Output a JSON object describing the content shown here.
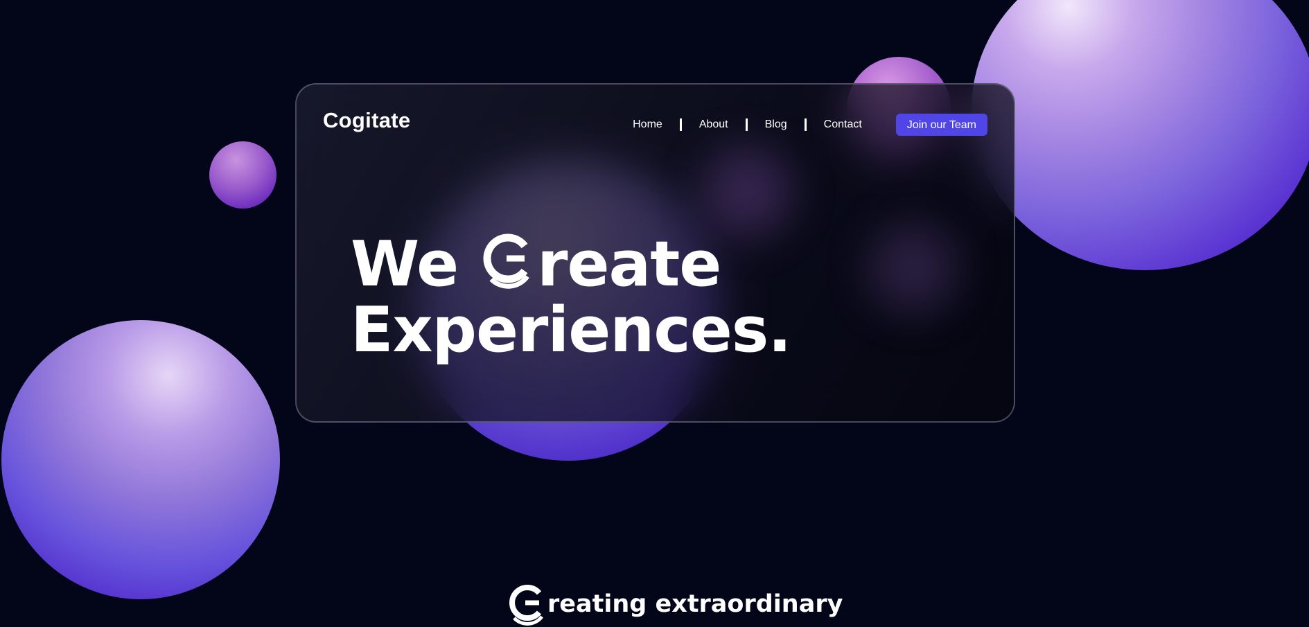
{
  "brand": {
    "name": "Cogitate"
  },
  "nav": {
    "items": [
      {
        "label": "Home"
      },
      {
        "label": "About"
      },
      {
        "label": "Blog"
      },
      {
        "label": "Contact"
      }
    ],
    "cta_label": "Join our Team"
  },
  "hero": {
    "line1_prefix": "We",
    "line1_suffix": "reate",
    "line2": "Experiences."
  },
  "tagline": {
    "text": "reating extraordinary"
  },
  "colors": {
    "background": "#030519",
    "accent": "#5045e6",
    "sphere_purple": "#4a1ec4",
    "sphere_lilac": "#c8a8ec"
  },
  "icons": {
    "brand_mark": "c-logo-icon"
  }
}
